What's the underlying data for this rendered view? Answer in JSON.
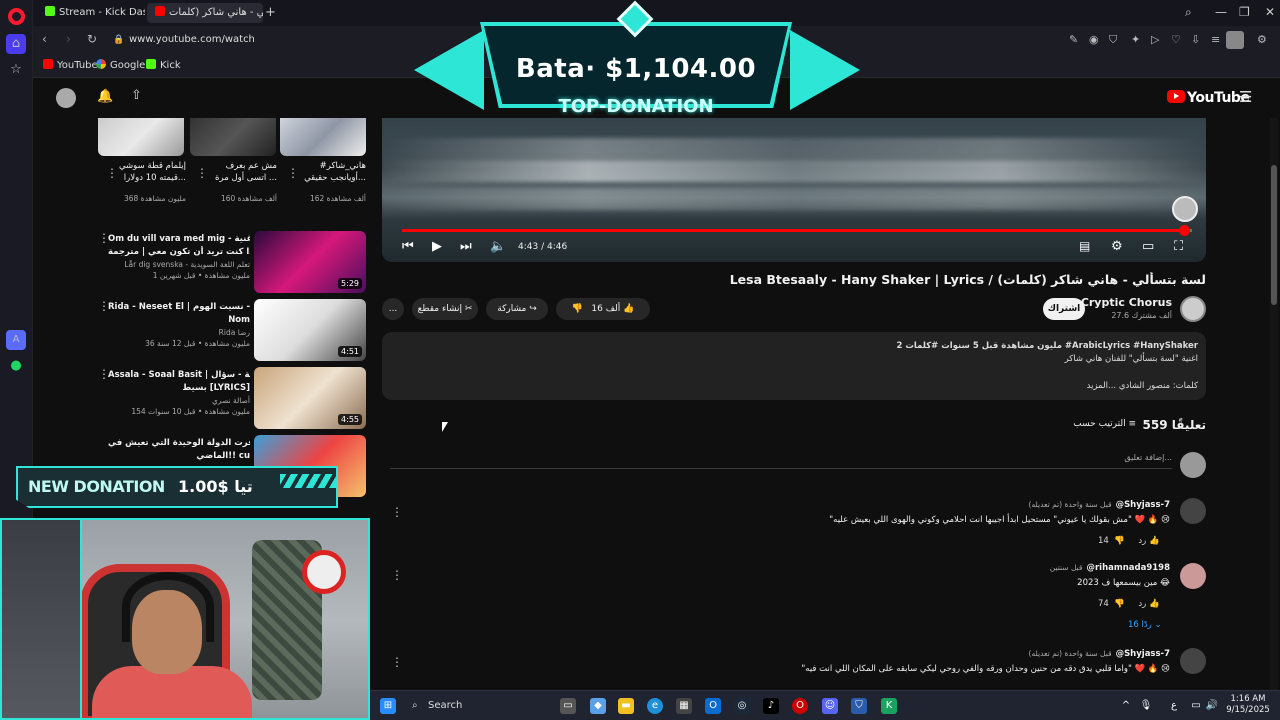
{
  "browser": {
    "tabs": [
      {
        "label": "Stream - Kick Dashboard"
      },
      {
        "label": "لسة بتسألي - هاني شاكر (كلمات"
      }
    ],
    "url": "www.youtube.com/watch",
    "bookmarks": [
      "YouTube",
      "Google",
      "Kick"
    ]
  },
  "youtube": {
    "logo": "YouTube",
    "video": {
      "time": "4:43 / 4:46",
      "progress": 0.99,
      "title": "Lesa Btesaaly - Hany Shaker | Lyrics / لسة بتسألي - هاني شاكر (كلمات)"
    },
    "channel": {
      "name": "Cryptic Chorus",
      "subs": "27.6 ألف مشترك",
      "subscribe": "اشتراك"
    },
    "actions": {
      "likes": "16 ألف",
      "share": "مشاركة",
      "clip": "إنشاء مقطع",
      "more": "..."
    },
    "description": {
      "line1": "2 مليون مشاهدة  قبل 5 سنوات  #كلمات  #ArabicLyrics #HanyShaker",
      "line2": "اغنية \"لسة بتسألي\" للفنان هاني شاكر",
      "line3": "كلمات: منصور الشادي  ...المزيد"
    },
    "comments": {
      "count": "559 تعليقًا",
      "sort": "الترتيب حسب",
      "add_placeholder": "إضافة تعليق...",
      "items": [
        {
          "user": "@Shyjass-7",
          "time": "قبل سنة واحدة (تم تعديله)",
          "text": "\"مش بقولك يا عيوني\" مستحيل ابدأ اجيبها انت احلامي وكوني والهوى اللي بعيش عليه\" ❤️ 🔥 😢",
          "likes": "14",
          "reply": "رد"
        },
        {
          "user": "@rihamnada9198",
          "time": "قبل سنتين",
          "text": "مين بيسمعها ف 2023 😂",
          "likes": "74",
          "reply": "رد",
          "replies": "16 ردًا"
        },
        {
          "user": "@Shyjass-7",
          "time": "قبل سنة واحدة (تم تعديله)",
          "text": "\"واما قلبي يدق دقه من حنين وحدان ورقه والفي روحي ليكي سابقه على المكان اللي انت فيه\" ❤️ 🔥 😢"
        }
      ]
    },
    "shorts": [
      {
        "title1": "إيلمام قطة سوشي",
        "title2": "قيمته 10 دولارا...",
        "views": "368 مليون مشاهدة"
      },
      {
        "title1": "مش عم بعرف",
        "title2": "اتسى أول مرة ...",
        "views": "160 ألف مشاهدة"
      },
      {
        "title1": "#هاني_شاكر",
        "title2": "أويانجب حقيقي...",
        "views": "162 ألف مشاهدة"
      }
    ],
    "related": [
      {
        "title": "Om du vill vara med mig - اغنية",
        "title2": "إذا كنت تريد أن تكون معي | مترجمة + ...",
        "channel": "Lår dig svenska - تعلم اللغة السويدية",
        "views": "1 مليون مشاهدة • قبل شهرين",
        "duration": "5:29"
      },
      {
        "title": "Rida - Neseet El | رضا - نسيت الهوم",
        "title2": "Nom",
        "channel": "Rida رضا",
        "views": "36 مليون مشاهدة • قبل 12 سنة",
        "duration": "4:51"
      },
      {
        "title": "Assala - Soaal Basit | أصالة - سؤال",
        "title2": "بسيط [LYRICS]",
        "channel": "أصالة نصري",
        "views": "154 مليون مشاهدة • قبل 10 سنوات",
        "duration": "4:55"
      },
      {
        "title": "سافرت الدولة الوحيدة التي تعيش في",
        "title2": "الماضي!! cu",
        "channel": "",
        "views": "",
        "duration": ""
      }
    ]
  },
  "overlays": {
    "top_donation_amount": "Bata· $1,104.00",
    "top_donation_label": "TOP-DONATION",
    "new_donation_label": "NEW DONATION",
    "new_donation_amount": "1.00$ تيا",
    "accent": "#2ee6d6"
  },
  "taskbar": {
    "search": "Search",
    "time": "1:16 AM",
    "date": "9/15/2025"
  }
}
